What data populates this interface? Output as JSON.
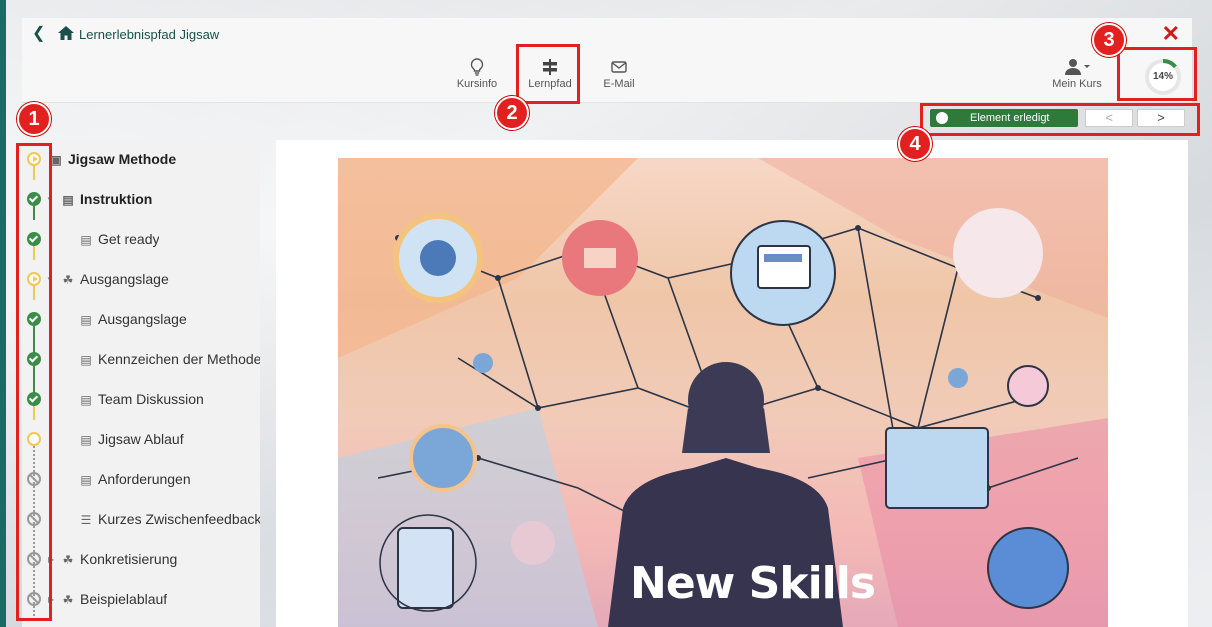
{
  "header": {
    "title": "Lernerlebnispfad Jigsaw"
  },
  "toolbar": {
    "kursinfo": "Kursinfo",
    "lernpfad": "Lernpfad",
    "email": "E-Mail",
    "mein_kurs": "Mein Kurs",
    "progress_label": "14%",
    "progress_value": 0.14
  },
  "annotations": [
    "1",
    "2",
    "3",
    "4"
  ],
  "element_bar": {
    "done_label": "Element erledigt",
    "prev": "<",
    "next": ">"
  },
  "sidebar": {
    "items": [
      {
        "label": "Jigsaw Methode",
        "status": "in-progress",
        "icon": "book-icon"
      },
      {
        "label": "Instruktion",
        "status": "done",
        "icon": "document-icon"
      },
      {
        "label": "Get ready",
        "status": "done",
        "icon": "document-icon"
      },
      {
        "label": "Ausgangslage",
        "status": "in-progress",
        "icon": "structure-icon"
      },
      {
        "label": "Ausgangslage",
        "status": "done",
        "icon": "document-icon"
      },
      {
        "label": "Kennzeichen der Methode",
        "status": "done",
        "icon": "document-icon"
      },
      {
        "label": "Team Diskussion",
        "status": "done",
        "icon": "document-icon"
      },
      {
        "label": "Jigsaw Ablauf",
        "status": "open",
        "icon": "document-icon"
      },
      {
        "label": "Anforderungen",
        "status": "locked",
        "icon": "document-icon"
      },
      {
        "label": "Kurzes Zwischenfeedback",
        "status": "locked",
        "icon": "survey-icon"
      },
      {
        "label": "Konkretisierung",
        "status": "locked",
        "icon": "structure-icon"
      },
      {
        "label": "Beispielablauf",
        "status": "locked",
        "icon": "structure-icon"
      }
    ]
  },
  "content": {
    "hero_text": "New Skills"
  },
  "colors": {
    "brand": "#19504a",
    "done": "#3a8d48",
    "progress": "#f2c94c",
    "annotation": "#e32020"
  }
}
